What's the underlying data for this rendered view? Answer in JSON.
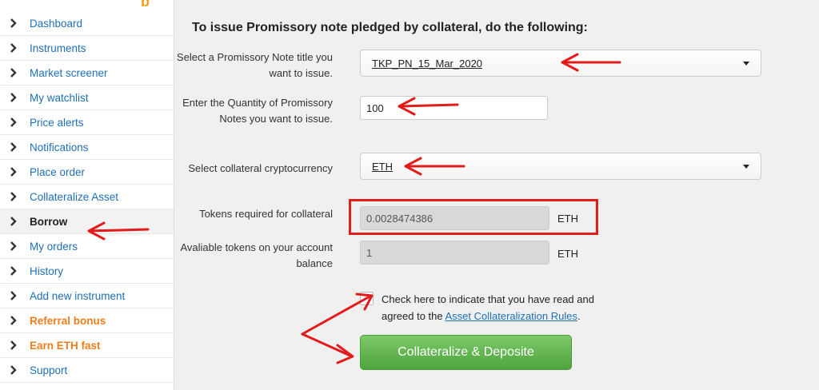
{
  "sidebar": {
    "items": [
      {
        "label": "Dashboard",
        "style": "normal"
      },
      {
        "label": "Instruments",
        "style": "normal"
      },
      {
        "label": "Market screener",
        "style": "normal"
      },
      {
        "label": "My watchlist",
        "style": "normal"
      },
      {
        "label": "Price alerts",
        "style": "normal"
      },
      {
        "label": "Notifications",
        "style": "normal"
      },
      {
        "label": "Place order",
        "style": "normal"
      },
      {
        "label": "Collateralize Asset",
        "style": "normal"
      },
      {
        "label": "Borrow",
        "style": "active"
      },
      {
        "label": "My orders",
        "style": "normal"
      },
      {
        "label": "History",
        "style": "normal"
      },
      {
        "label": "Add new instrument",
        "style": "normal"
      },
      {
        "label": "Referral bonus",
        "style": "orange"
      },
      {
        "label": "Earn ETH fast",
        "style": "orange"
      },
      {
        "label": "Support",
        "style": "normal"
      }
    ]
  },
  "form": {
    "heading": "To issue Promissory note pledged by collateral, do the following:",
    "note_title": {
      "label": "Select a Promissory Note title you want to issue.",
      "value": "TKP_PN_15_Mar_2020"
    },
    "quantity": {
      "label": "Enter the Quantity of Promissory Notes you want to issue.",
      "value": "100"
    },
    "collateral": {
      "label": "Select collateral cryptocurrency",
      "value": "ETH"
    },
    "tokens_required": {
      "label": "Tokens required for collateral",
      "value": "0.0028474386",
      "unit": "ETH"
    },
    "available": {
      "label": "Avaliable tokens on your account balance",
      "value": "1",
      "unit": "ETH"
    },
    "agree": {
      "text_before": "Check here to indicate that you have read and agreed to the ",
      "link": "Asset Collateralization Rules",
      "text_after": "."
    },
    "submit_label": "Collateralize & Deposite"
  },
  "colors": {
    "annotation": "#e21b1b",
    "link": "#1f6fb5",
    "accent_orange": "#f07d1a",
    "button_green": "#5cb04a"
  }
}
